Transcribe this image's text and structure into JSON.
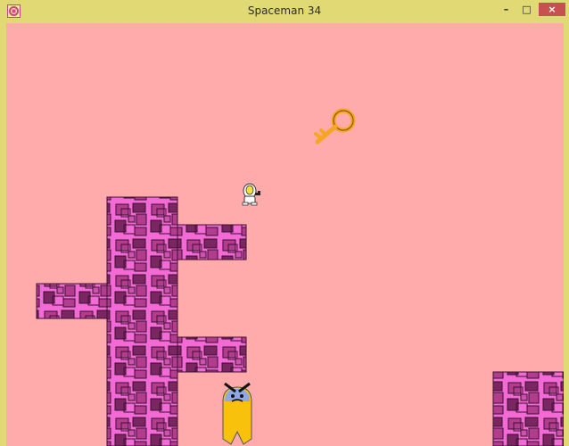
{
  "window": {
    "title": "Spaceman 34",
    "controls": {
      "minimize": "–",
      "maximize": "□",
      "close": "×"
    }
  },
  "icons": {
    "app": "app-icon",
    "player": "spaceman-icon",
    "key": "key-icon",
    "enemy": "angry-yellow-monster-icon"
  },
  "colors": {
    "sky": "#ffabab",
    "brick": "#f26ad6",
    "brick_dark": "#6e2450",
    "key": "#f5a623",
    "enemy_body": "#f8c10b",
    "enemy_head": "#8fa7e6",
    "title_bar": "#e1d974"
  }
}
